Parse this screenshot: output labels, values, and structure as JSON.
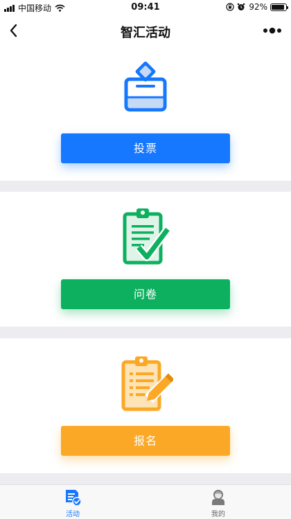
{
  "status_bar": {
    "carrier": "中国移动",
    "time": "09:41",
    "battery": "92%",
    "battery_level": 0.92,
    "icons": [
      "signal-icon",
      "wifi-icon",
      "orientation-lock-icon",
      "alarm-icon",
      "battery-icon"
    ]
  },
  "nav": {
    "title": "智汇活动",
    "back_icon": "chevron-left-icon",
    "more_icon": "more-dots-icon"
  },
  "cards": [
    {
      "label": "投票",
      "icon": "ballot-box-icon",
      "color": "#1677ff"
    },
    {
      "label": "问卷",
      "icon": "questionnaire-clipboard-icon",
      "color": "#0db05f"
    },
    {
      "label": "报名",
      "icon": "signup-clipboard-pencil-icon",
      "color": "#fba826"
    }
  ],
  "tabbar": {
    "tabs": [
      {
        "label": "活动",
        "icon": "activity-doc-check-icon",
        "active": true,
        "color": "#1677ff"
      },
      {
        "label": "我的",
        "icon": "user-avatar-icon",
        "active": false,
        "color": "#666666"
      }
    ]
  }
}
